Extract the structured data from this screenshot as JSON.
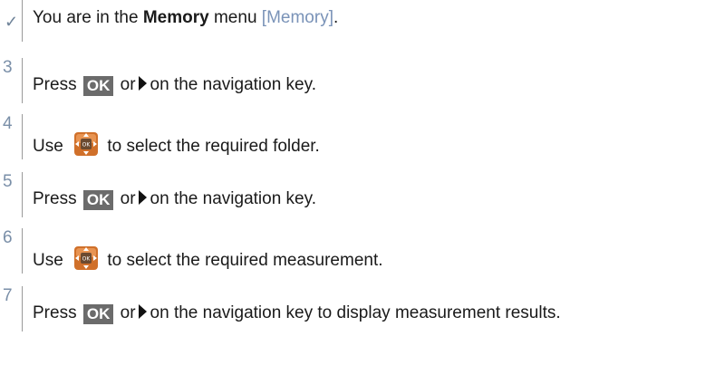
{
  "precondition": {
    "prefix": "You are in the",
    "menu_name": "Memory",
    "menu_word": "menu",
    "menu_ref": "[Memory]",
    "suffix": "."
  },
  "steps": [
    {
      "num": "3",
      "t1": "Press",
      "key": "OK",
      "t2": "or",
      "t3": "on the navigation key."
    },
    {
      "num": "4",
      "t1": "Use",
      "t3": "to select the required folder."
    },
    {
      "num": "5",
      "t1": "Press",
      "key": "OK",
      "t2": "or",
      "t3": "on the navigation key."
    },
    {
      "num": "6",
      "t1": "Use",
      "t3": "to select the required measurement."
    },
    {
      "num": "7",
      "t1": "Press",
      "key": "OK",
      "t2": "or",
      "t3": "on the navigation key to display measurement results."
    }
  ],
  "icons": {
    "check": "check-icon",
    "arrow": "triangle-right-icon",
    "navkey": "navigation-key-icon",
    "navkey_label": "OK"
  },
  "colors": {
    "link": "#7a93b8",
    "key_bg": "#6b6b6b",
    "navkey": "#d0702a"
  }
}
